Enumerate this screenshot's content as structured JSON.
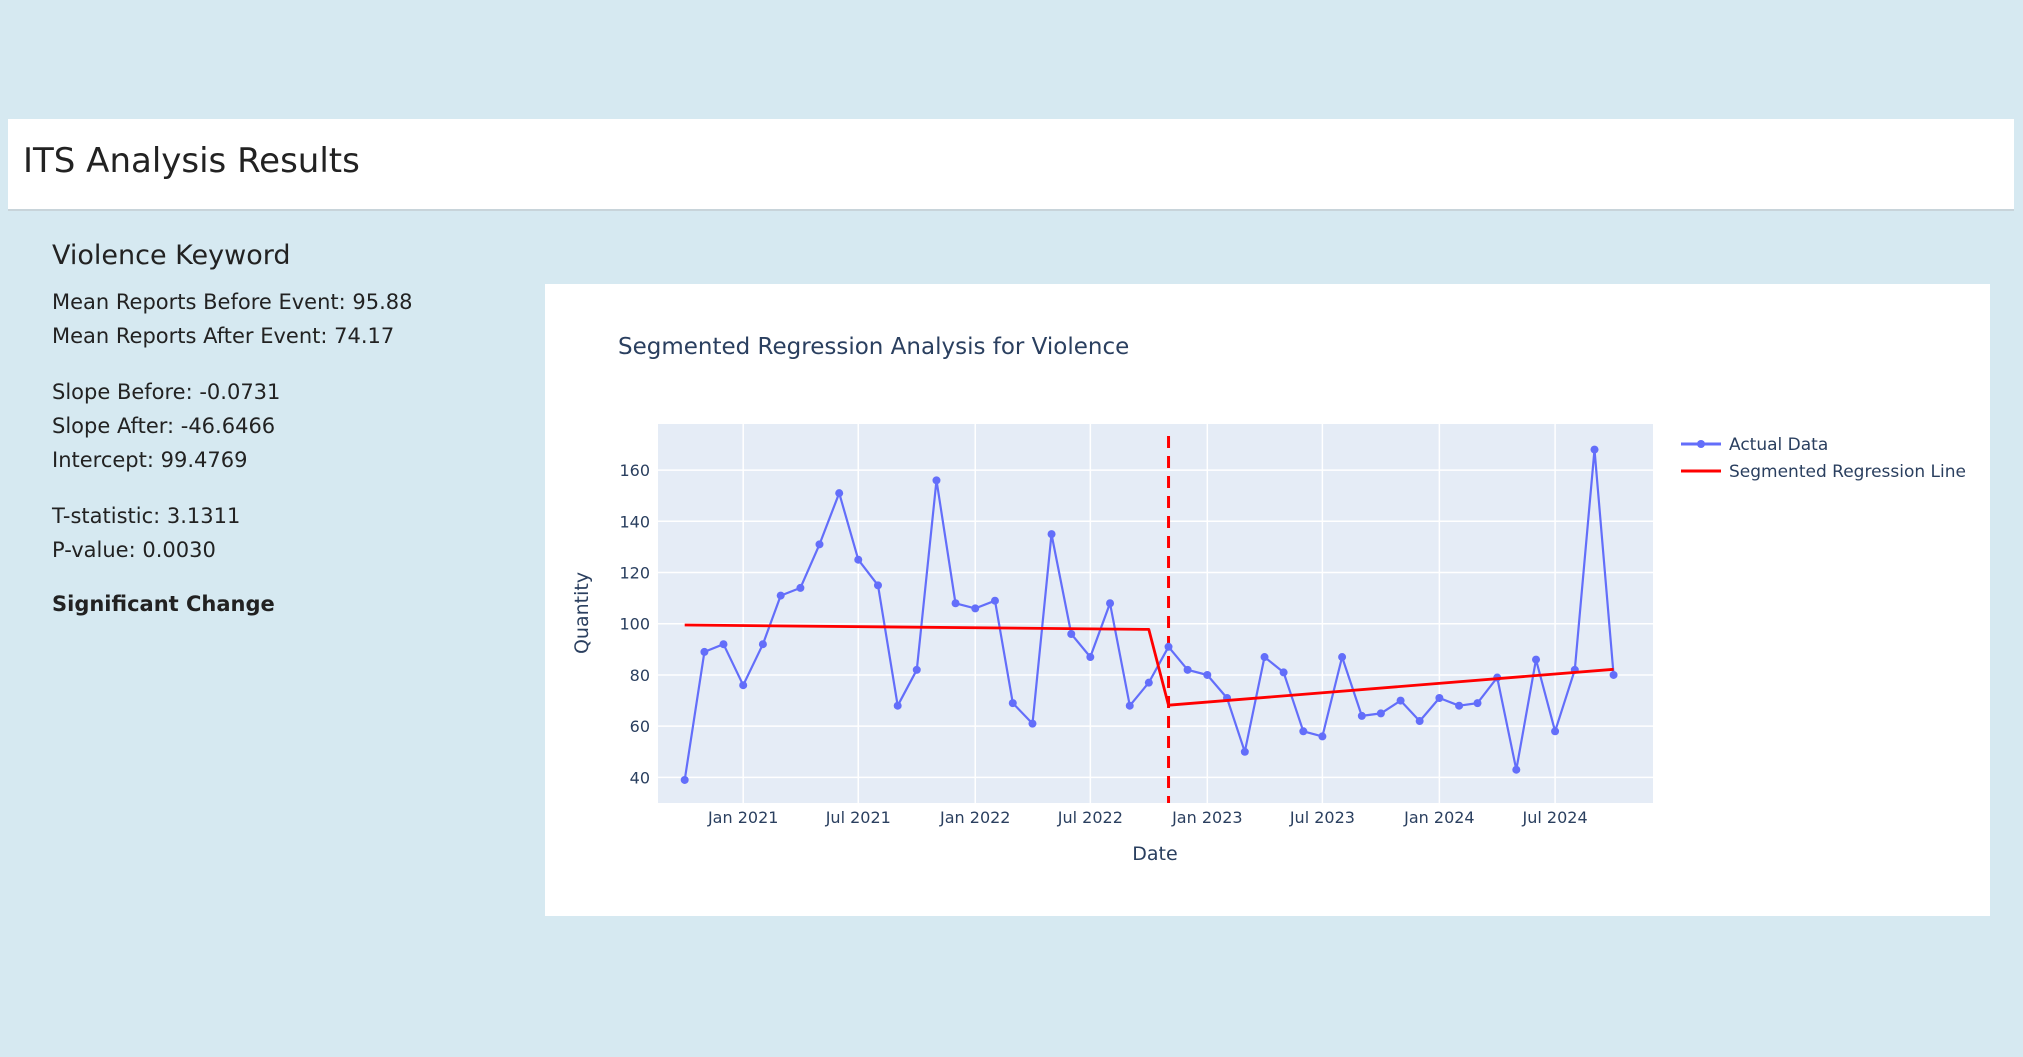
{
  "header": {
    "title": "ITS Analysis Results"
  },
  "stats": {
    "heading": "Violence Keyword",
    "mean_before": "Mean Reports Before Event: 95.88",
    "mean_after": "Mean Reports After Event: 74.17",
    "slope_before": "Slope Before: -0.0731",
    "slope_after": "Slope After: -46.6466",
    "intercept": "Intercept: 99.4769",
    "t_stat": "T-statistic: 3.1311",
    "p_value": "P-value: 0.0030",
    "conclusion": "Significant Change"
  },
  "chart_data": {
    "type": "line",
    "title": "Segmented Regression Analysis for Violence",
    "xlabel": "Date",
    "ylabel": "Quantity",
    "ylim": [
      30,
      178
    ],
    "xlim": [
      "2020-08-20",
      "2024-12-02"
    ],
    "yticks": [
      40,
      60,
      80,
      100,
      120,
      140,
      160
    ],
    "xticks": [
      {
        "date": "2021-01-01",
        "label": "Jan 2021"
      },
      {
        "date": "2021-07-01",
        "label": "Jul 2021"
      },
      {
        "date": "2022-01-01",
        "label": "Jan 2022"
      },
      {
        "date": "2022-07-01",
        "label": "Jul 2022"
      },
      {
        "date": "2023-01-01",
        "label": "Jan 2023"
      },
      {
        "date": "2023-07-01",
        "label": "Jul 2023"
      },
      {
        "date": "2024-01-01",
        "label": "Jan 2024"
      },
      {
        "date": "2024-07-01",
        "label": "Jul 2024"
      }
    ],
    "grid": true,
    "legend_position": "right",
    "series": [
      {
        "name": "Actual Data",
        "color": "#636efa",
        "mode": "lines+markers",
        "x": [
          "2020-10-01",
          "2020-11-01",
          "2020-12-01",
          "2021-01-01",
          "2021-02-01",
          "2021-03-01",
          "2021-04-01",
          "2021-05-01",
          "2021-06-01",
          "2021-07-01",
          "2021-08-01",
          "2021-09-01",
          "2021-10-01",
          "2021-11-01",
          "2021-12-01",
          "2022-01-01",
          "2022-02-01",
          "2022-03-01",
          "2022-04-01",
          "2022-05-01",
          "2022-06-01",
          "2022-07-01",
          "2022-08-01",
          "2022-09-01",
          "2022-10-01",
          "2022-11-01",
          "2022-12-01",
          "2023-01-01",
          "2023-02-01",
          "2023-03-01",
          "2023-04-01",
          "2023-05-01",
          "2023-06-01",
          "2023-07-01",
          "2023-08-01",
          "2023-09-01",
          "2023-10-01",
          "2023-11-01",
          "2023-12-01",
          "2024-01-01",
          "2024-02-01",
          "2024-03-01",
          "2024-04-01",
          "2024-05-01",
          "2024-06-01",
          "2024-07-01",
          "2024-08-01",
          "2024-09-01",
          "2024-10-01"
        ],
        "values": [
          39,
          89,
          92,
          76,
          92,
          111,
          114,
          131,
          151,
          125,
          115,
          68,
          82,
          156,
          108,
          106,
          109,
          69,
          61,
          135,
          96,
          87,
          108,
          68,
          77,
          91,
          82,
          80,
          71,
          50,
          87,
          81,
          58,
          56,
          87,
          64,
          65,
          70,
          62,
          71,
          68,
          69,
          79,
          43,
          86,
          58,
          82,
          168,
          80
        ]
      },
      {
        "name": "Segmented Regression Line",
        "color": "#ff0000",
        "mode": "lines",
        "x": [
          "2020-10-01",
          "2022-10-01",
          "2022-11-01",
          "2024-10-01"
        ],
        "values": [
          99.5,
          97.8,
          68.2,
          82.2
        ]
      }
    ],
    "event_line": {
      "date": "2022-11-01",
      "color": "#ff0000",
      "style": "dashed"
    }
  }
}
